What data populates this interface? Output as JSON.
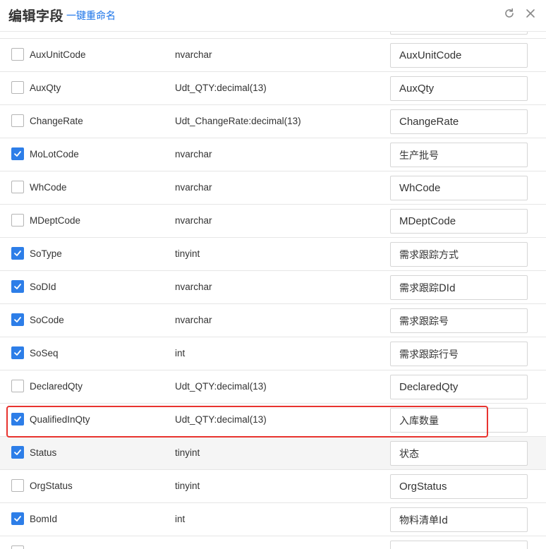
{
  "header": {
    "title": "编辑字段",
    "rename_link": "一键重命名",
    "refresh_icon": "refresh-icon",
    "close_icon": "close-icon"
  },
  "colors": {
    "accent": "#2d7ee8",
    "link": "#1a73e8",
    "highlight": "#e8332f"
  },
  "fields": [
    {
      "name": "",
      "type": "",
      "alias": "",
      "checked": false
    },
    {
      "name": "AuxUnitCode",
      "type": "nvarchar",
      "alias": "AuxUnitCode",
      "checked": false
    },
    {
      "name": "AuxQty",
      "type": "Udt_QTY:decimal(13)",
      "alias": "AuxQty",
      "checked": false
    },
    {
      "name": "ChangeRate",
      "type": "Udt_ChangeRate:decimal(13)",
      "alias": "ChangeRate",
      "checked": false
    },
    {
      "name": "MoLotCode",
      "type": "nvarchar",
      "alias": "生产批号",
      "checked": true
    },
    {
      "name": "WhCode",
      "type": "nvarchar",
      "alias": "WhCode",
      "checked": false
    },
    {
      "name": "MDeptCode",
      "type": "nvarchar",
      "alias": "MDeptCode",
      "checked": false
    },
    {
      "name": "SoType",
      "type": "tinyint",
      "alias": "需求跟踪方式",
      "checked": true
    },
    {
      "name": "SoDId",
      "type": "nvarchar",
      "alias": "需求跟踪DId",
      "checked": true
    },
    {
      "name": "SoCode",
      "type": "nvarchar",
      "alias": "需求跟踪号",
      "checked": true
    },
    {
      "name": "SoSeq",
      "type": "int",
      "alias": "需求跟踪行号",
      "checked": true
    },
    {
      "name": "DeclaredQty",
      "type": "Udt_QTY:decimal(13)",
      "alias": "DeclaredQty",
      "checked": false
    },
    {
      "name": "QualifiedInQty",
      "type": "Udt_QTY:decimal(13)",
      "alias": "入库数量",
      "checked": true
    },
    {
      "name": "Status",
      "type": "tinyint",
      "alias": "状态",
      "checked": true
    },
    {
      "name": "OrgStatus",
      "type": "tinyint",
      "alias": "OrgStatus",
      "checked": false
    },
    {
      "name": "BomId",
      "type": "int",
      "alias": "物料清单Id",
      "checked": true
    },
    {
      "name": "",
      "type": "",
      "alias": "",
      "checked": false
    }
  ]
}
